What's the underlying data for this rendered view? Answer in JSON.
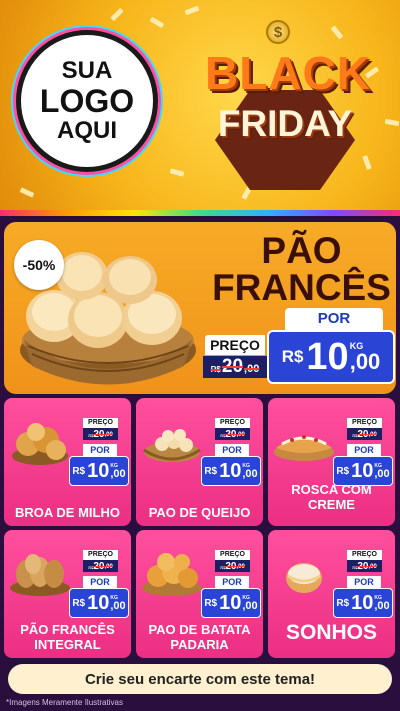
{
  "header": {
    "logo_lines": [
      "SUA",
      "LOGO",
      "AQUI"
    ],
    "coin_symbol": "$",
    "title_line1": "BLACK",
    "title_line2": "FRIDAY"
  },
  "featured": {
    "discount": "-50%",
    "name_line1": "PÃO",
    "name_line2": "FRANCÊS",
    "old_label": "PREÇO",
    "old_currency": "R$",
    "old_int": "20",
    "old_cents": ",00",
    "new_label": "POR",
    "new_currency": "R$",
    "new_int": "10",
    "new_cents": ",00",
    "unit": "KG"
  },
  "products": [
    {
      "name": "BROA DE MILHO",
      "image_icon": "corn-bread-icon",
      "old_label": "PREÇO",
      "old_currency": "R$",
      "old_int": "20",
      "old_cents": ",00",
      "new_label": "POR",
      "new_currency": "R$",
      "new_int": "10",
      "new_cents": ",00",
      "unit": "KG"
    },
    {
      "name": "PAO DE QUEIJO",
      "image_icon": "cheese-bread-icon",
      "old_label": "PREÇO",
      "old_currency": "R$",
      "old_int": "20",
      "old_cents": ",00",
      "new_label": "POR",
      "new_currency": "R$",
      "new_int": "10",
      "new_cents": ",00",
      "unit": "KG"
    },
    {
      "name": "ROSCA COM CREME",
      "image_icon": "cream-roll-icon",
      "old_label": "PREÇO",
      "old_currency": "R$",
      "old_int": "20",
      "old_cents": ",00",
      "new_label": "POR",
      "new_currency": "R$",
      "new_int": "10",
      "new_cents": ",00",
      "unit": "KG"
    },
    {
      "name": "PÃO FRANCÊS INTEGRAL",
      "image_icon": "whole-bread-icon",
      "old_label": "PREÇO",
      "old_currency": "R$",
      "old_int": "20",
      "old_cents": ",00",
      "new_label": "POR",
      "new_currency": "R$",
      "new_int": "10",
      "new_cents": ",00",
      "unit": "KG"
    },
    {
      "name": "PAO DE BATATA PADARIA",
      "image_icon": "potato-bread-icon",
      "old_label": "PREÇO",
      "old_currency": "R$",
      "old_int": "20",
      "old_cents": ",00",
      "new_label": "POR",
      "new_currency": "R$",
      "new_int": "10",
      "new_cents": ",00",
      "unit": "KG"
    },
    {
      "name": "SONHOS",
      "image_icon": "donut-icon",
      "old_label": "PREÇO",
      "old_currency": "R$",
      "old_int": "20",
      "old_cents": ",00",
      "new_label": "POR",
      "new_currency": "R$",
      "new_int": "10",
      "new_cents": ",00",
      "unit": "KG"
    }
  ],
  "cta": "Crie seu encarte com este tema!",
  "disclaimer": "*Imagens Meramente Ilustrativas",
  "colors": {
    "header_yellow": "#f7b51a",
    "featured_orange": "#f29a1e",
    "card_pink": "#ec2f84",
    "price_blue": "#2a44d6",
    "old_price_navy": "#1e1e64",
    "background": "#2a0f3e"
  }
}
